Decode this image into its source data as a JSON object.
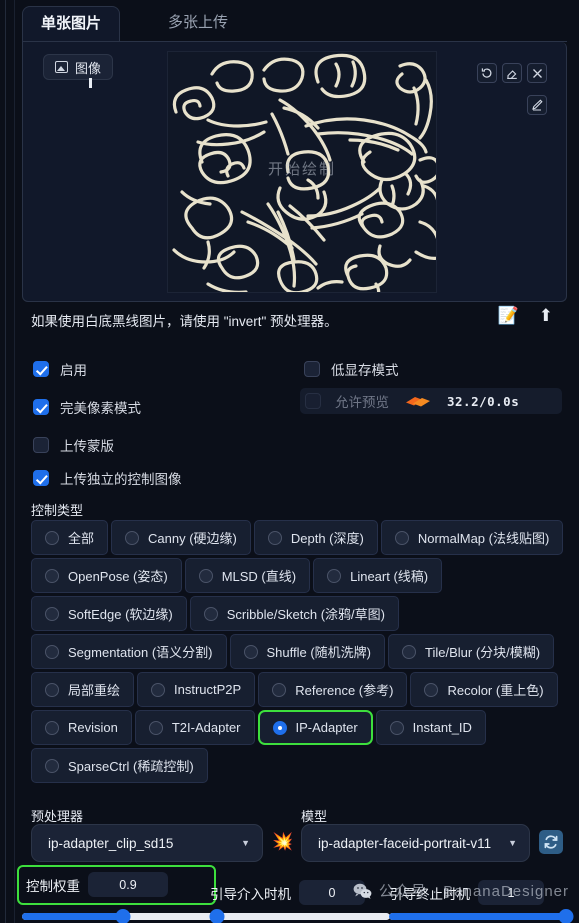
{
  "tabs": [
    {
      "label": "单张图片",
      "active": true
    },
    {
      "label": "多张上传",
      "active": false
    }
  ],
  "image_panel": {
    "subtab_label": "图像",
    "subtab_icon": "image-icon",
    "canvas_overlay_text": "开始绘制",
    "buttons": [
      {
        "name": "undo",
        "icon": "undo-icon"
      },
      {
        "name": "erase",
        "icon": "eraser-icon"
      },
      {
        "name": "close",
        "icon": "close-icon"
      },
      {
        "name": "pen",
        "icon": "pen-icon"
      }
    ]
  },
  "hint": {
    "text": "如果使用白底黑线图片，请使用 \"invert\" 预处理器。",
    "edit_icon": "📝",
    "upload_icon": "⬆"
  },
  "checkboxes": {
    "enable": {
      "label": "启用",
      "checked": true
    },
    "pixel_perfect": {
      "label": "完美像素模式",
      "checked": true
    },
    "upload_mask": {
      "label": "上传蒙版",
      "checked": false
    },
    "independent_control_image": {
      "label": "上传独立的控制图像",
      "checked": true
    },
    "low_vram": {
      "label": "低显存模式",
      "checked": false
    },
    "allow_preview": {
      "label": "允许预览",
      "checked": false,
      "disabled": true
    }
  },
  "timing_readout": "32.2/0.0s",
  "control_type": {
    "label": "控制类型",
    "selected": "IP-Adapter",
    "rows": [
      [
        "全部",
        "Canny (硬边缘)",
        "Depth (深度)",
        "NormalMap (法线贴图)"
      ],
      [
        "OpenPose (姿态)",
        "MLSD (直线)",
        "Lineart (线稿)"
      ],
      [
        "SoftEdge (软边缘)",
        "Scribble/Sketch (涂鸦/草图)"
      ],
      [
        "Segmentation (语义分割)",
        "Shuffle (随机洗牌)",
        "Tile/Blur (分块/模糊)"
      ],
      [
        "局部重绘",
        "InstructP2P",
        "Reference (参考)",
        "Recolor (重上色)"
      ],
      [
        "Revision",
        "T2I-Adapter",
        "IP-Adapter",
        "Instant_ID"
      ],
      [
        "SparseCtrl (稀疏控制)"
      ]
    ]
  },
  "preprocessor": {
    "label": "预处理器",
    "value": "ip-adapter_clip_sd15",
    "explode_icon": "💥"
  },
  "model": {
    "label": "模型",
    "value": "ip-adapter-faceid-portrait-v11",
    "refresh_icon": "refresh-icon"
  },
  "sliders": {
    "control_weight": {
      "label": "控制权重",
      "value": "0.9",
      "percent": 52,
      "highlighted": true
    },
    "guidance_start": {
      "label": "引导介入时机",
      "value": "0",
      "percent": 0
    },
    "guidance_end": {
      "label": "引导终止时机",
      "value": "1",
      "percent": 100
    }
  },
  "watermark": "公众号 · BananaDesigner",
  "colors": {
    "accent_blue": "#1f6feb",
    "highlight_green": "#3ddf3d",
    "panel_bg": "#11182a",
    "page_bg": "#0b0f19"
  }
}
